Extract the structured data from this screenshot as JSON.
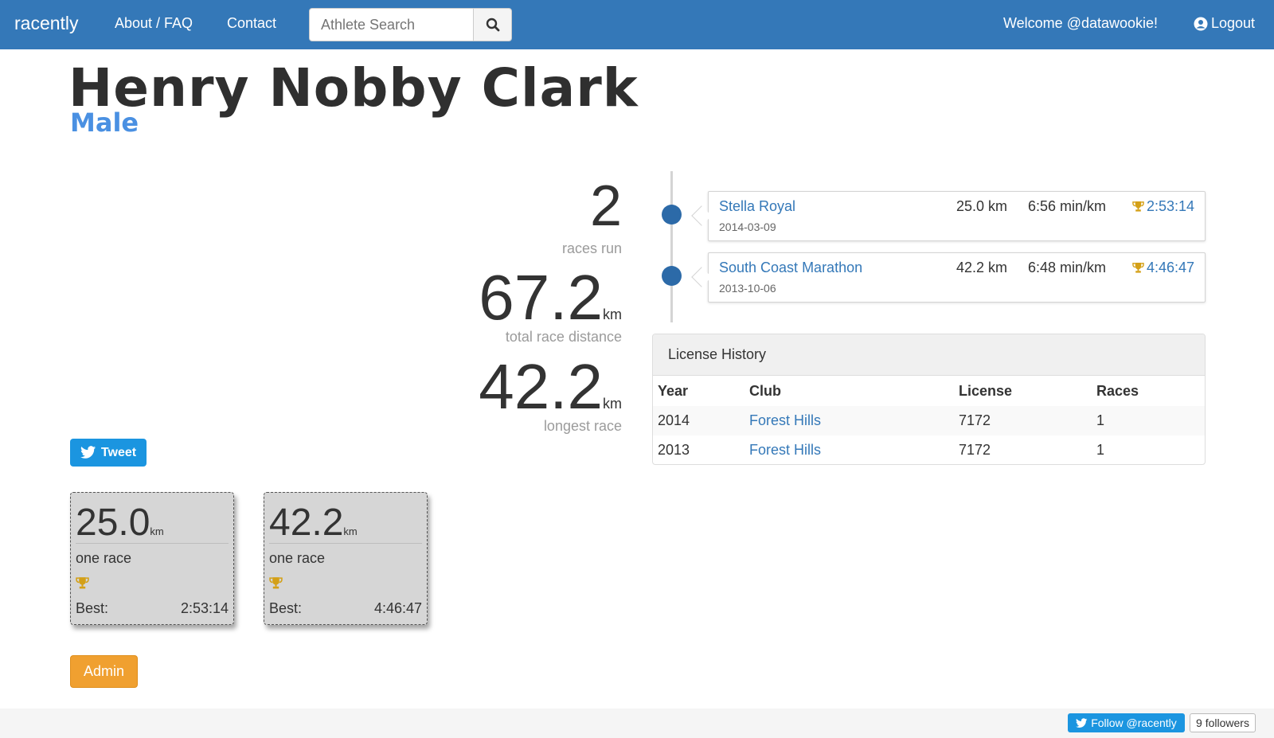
{
  "nav": {
    "brand": "racently",
    "links": [
      "About / FAQ",
      "Contact"
    ],
    "search_placeholder": "Athlete Search",
    "welcome": "Welcome @datawookie!",
    "logout": "Logout"
  },
  "athlete": {
    "name": "Henry Nobby Clark",
    "sex": "Male"
  },
  "stats": {
    "races_run": "2",
    "races_run_label": "races run",
    "total_distance": "67.2",
    "total_distance_unit": "km",
    "total_distance_label": "total race distance",
    "longest_race": "42.2",
    "longest_race_unit": "km",
    "longest_race_label": "longest race"
  },
  "timeline": [
    {
      "race": "Stella Royal",
      "date": "2014-03-09",
      "distance": "25.0 km",
      "pace": "6:56 min/km",
      "time": "2:53:14"
    },
    {
      "race": "South Coast Marathon",
      "date": "2013-10-06",
      "distance": "42.2 km",
      "pace": "6:48 min/km",
      "time": "4:46:47"
    }
  ],
  "license": {
    "title": "License History",
    "headers": [
      "Year",
      "Club",
      "License",
      "Races"
    ],
    "rows": [
      {
        "year": "2014",
        "club": "Forest Hills",
        "license": "7172",
        "races": "1"
      },
      {
        "year": "2013",
        "club": "Forest Hills",
        "license": "7172",
        "races": "1"
      }
    ]
  },
  "tweet_label": "Tweet",
  "distance_cards": [
    {
      "distance": "25.0",
      "unit": "km",
      "count": "one race",
      "best_label": "Best:",
      "best_time": "2:53:14"
    },
    {
      "distance": "42.2",
      "unit": "km",
      "count": "one race",
      "best_label": "Best:",
      "best_time": "4:46:47"
    }
  ],
  "admin_label": "Admin",
  "footer": {
    "follow_label": "Follow @racently",
    "followers": "9 followers"
  },
  "colors": {
    "navbar": "#3478b8",
    "link": "#3478b8",
    "sex": "#4a90e2",
    "trophy": "#d4a017",
    "admin": "#f0a030",
    "twitter": "#1b95e0"
  }
}
